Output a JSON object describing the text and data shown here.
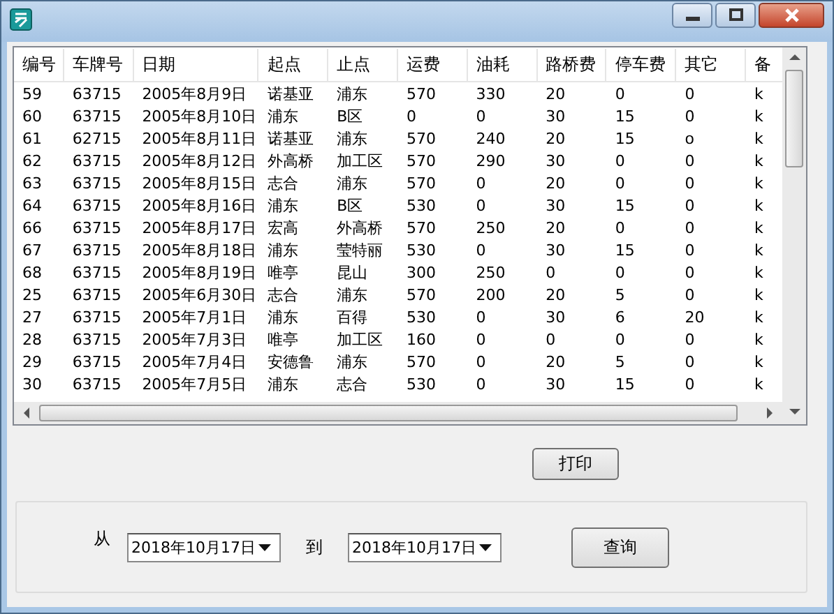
{
  "table": {
    "columns": [
      "编号",
      "车牌号",
      "日期",
      "起点",
      "止点",
      "运费",
      "油耗",
      "路桥费",
      "停车费",
      "其它",
      "备"
    ],
    "rows": [
      [
        "59",
        "63715",
        "2005年8月9日",
        "诺基亚",
        "浦东",
        "570",
        "330",
        "20",
        "0",
        "0",
        "k"
      ],
      [
        "60",
        "63715",
        "2005年8月10日",
        "浦东",
        "B区",
        "0",
        "0",
        "30",
        "15",
        "0",
        "k"
      ],
      [
        "61",
        "62715",
        "2005年8月11日",
        "诺基亚",
        "浦东",
        "570",
        "240",
        "20",
        "15",
        "o",
        "k"
      ],
      [
        "62",
        "63715",
        "2005年8月12日",
        "外高桥",
        "加工区",
        "570",
        "290",
        "30",
        "0",
        "0",
        "k"
      ],
      [
        "63",
        "63715",
        "2005年8月15日",
        "志合",
        "浦东",
        "570",
        "0",
        "20",
        "0",
        "0",
        "k"
      ],
      [
        "64",
        "63715",
        "2005年8月16日",
        "浦东",
        "B区",
        "530",
        "0",
        "30",
        "15",
        "0",
        "k"
      ],
      [
        "66",
        "63715",
        "2005年8月17日",
        "宏高",
        "外高桥",
        "570",
        "250",
        "20",
        "0",
        "0",
        "k"
      ],
      [
        "67",
        "63715",
        "2005年8月18日",
        "浦东",
        "莹特丽",
        "530",
        "0",
        "30",
        "15",
        "0",
        "k"
      ],
      [
        "68",
        "63715",
        "2005年8月19日",
        "唯亭",
        "昆山",
        "300",
        "250",
        "0",
        "0",
        "0",
        "k"
      ],
      [
        "25",
        "63715",
        "2005年6月30日",
        "志合",
        "浦东",
        "570",
        "200",
        "20",
        "5",
        "0",
        "k"
      ],
      [
        "27",
        "63715",
        "2005年7月1日",
        "浦东",
        "百得",
        "530",
        "0",
        "30",
        "6",
        "20",
        "k"
      ],
      [
        "28",
        "63715",
        "2005年7月3日",
        "唯亭",
        "加工区",
        "160",
        "0",
        "0",
        "0",
        "0",
        "k"
      ],
      [
        "29",
        "63715",
        "2005年7月4日",
        "安德鲁",
        "浦东",
        "570",
        "0",
        "20",
        "5",
        "0",
        "k"
      ],
      [
        "30",
        "63715",
        "2005年7月5日",
        "浦东",
        "志合",
        "530",
        "0",
        "30",
        "15",
        "0",
        "k"
      ]
    ]
  },
  "print_button": "打印",
  "filter": {
    "from_label": "从",
    "from_date": "2018年10月17日",
    "to_label": "到",
    "to_date": "2018年10月17日",
    "query_button": "查询"
  }
}
